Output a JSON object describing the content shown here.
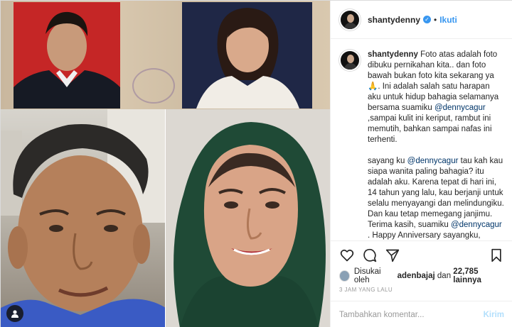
{
  "header": {
    "username": "shantydenny",
    "separator": "•",
    "follow_label": "Ikuti"
  },
  "caption": {
    "username": "shantydenny",
    "paragraph1": "Foto atas adalah foto dibuku pernikahan kita.. dan foto bawah bukan foto kita sekarang ya 🙏. Ini adalah salah satu harapan aku untuk hidup bahagia selamanya bersama suamiku",
    "mention1": "@dennycagur",
    "paragraph1_end": ",sampai kulit ini keriput, rambut ini memutih, bahkan sampai nafas ini terhenti.",
    "paragraph2_start": "sayang ku",
    "mention2": "@dennycagur",
    "paragraph2_mid": "tau kah kau siapa wanita paling bahagia? itu adalah aku. Karena tepat di hari ini, 14 tahun yang lalu, kau berjanji untuk selalu menyayangi dan melindungiku. Dan kau tetap memegang janjimu. Terima kasih, suamiku",
    "mention3": "@dennycagur",
    "paragraph2_end": ". Happy Anniversary sayangku, cintaku, hidupku, belahan jiwaku 🙏🙏❤🙏🙏🙏"
  },
  "likes": {
    "prefix": "Disukai oleh",
    "liker": "adenbajaj",
    "conjunction": "dan",
    "count_text": "22,785 lainnya"
  },
  "timestamp": "3 JAM YANG LALU",
  "comment": {
    "placeholder": "Tambahkan komentar...",
    "post_label": "Kirim"
  },
  "icons": {
    "like": "heart-icon",
    "comment": "comment-icon",
    "share": "share-icon",
    "save": "bookmark-icon",
    "tag": "user-tag-icon",
    "verified": "verified-badge-icon"
  },
  "colors": {
    "link": "#3897f0",
    "mention": "#003569",
    "post_button_disabled": "#b2dffc"
  }
}
